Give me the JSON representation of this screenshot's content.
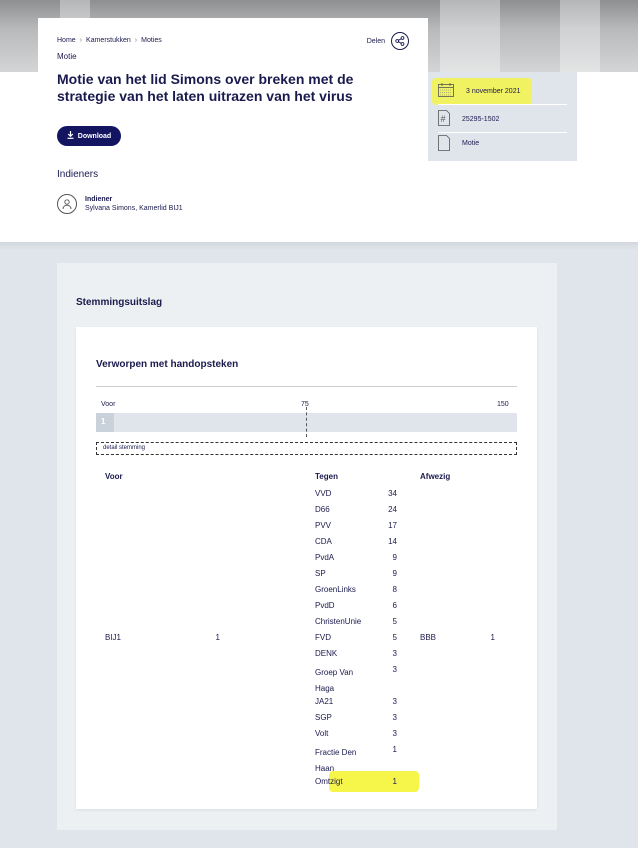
{
  "breadcrumb": {
    "home": "Home",
    "kamerstukken": "Kamerstukken",
    "moties": "Moties",
    "sep": "›"
  },
  "share": {
    "label": "Delen",
    "icon": "share-icon"
  },
  "doc_type": "Motie",
  "title": "Motie van het lid Simons over breken met de strategie van het laten uitrazen van het virus",
  "download_label": "Download",
  "indieners": {
    "heading": "Indieners",
    "role": "Indiener",
    "name": "Sylvana Simons, Kamerlid BIJ1"
  },
  "meta": {
    "date": "3 november 2021",
    "number": "25295-1502",
    "type": "Motie"
  },
  "stemming": {
    "heading": "Stemmingsuitslag",
    "result": "Verworpen met handopsteken",
    "axis": {
      "left": "Voor",
      "mid": "75",
      "right": "150",
      "max": 150
    },
    "voor_total": 1,
    "bar_value": "1",
    "detail_label": "detail stemming",
    "columns": {
      "voor": "Voor",
      "tegen": "Tegen",
      "afwezig": "Afwezig"
    },
    "voor": [
      {
        "party": "BIJ1",
        "seats": "1"
      }
    ],
    "tegen": [
      {
        "party": "VVD",
        "seats": "34"
      },
      {
        "party": "D66",
        "seats": "24"
      },
      {
        "party": "PVV",
        "seats": "17"
      },
      {
        "party": "CDA",
        "seats": "14"
      },
      {
        "party": "PvdA",
        "seats": "9"
      },
      {
        "party": "SP",
        "seats": "9"
      },
      {
        "party": "GroenLinks",
        "seats": "8"
      },
      {
        "party": "PvdD",
        "seats": "6"
      },
      {
        "party": "ChristenUnie",
        "seats": "5"
      },
      {
        "party": "FVD",
        "seats": "5"
      },
      {
        "party": "DENK",
        "seats": "3"
      },
      {
        "party": "Groep Van Haga",
        "seats": "3"
      },
      {
        "party": "JA21",
        "seats": "3"
      },
      {
        "party": "SGP",
        "seats": "3"
      },
      {
        "party": "Volt",
        "seats": "3"
      },
      {
        "party": "Fractie Den Haan",
        "seats": "1"
      },
      {
        "party": "Omtzigt",
        "seats": "1"
      }
    ],
    "afwezig": [
      {
        "party": "BBB",
        "seats": "1"
      }
    ]
  },
  "colors": {
    "navy": "#131561",
    "highlight": "#f5f54a",
    "panel": "#dfe5ea"
  }
}
